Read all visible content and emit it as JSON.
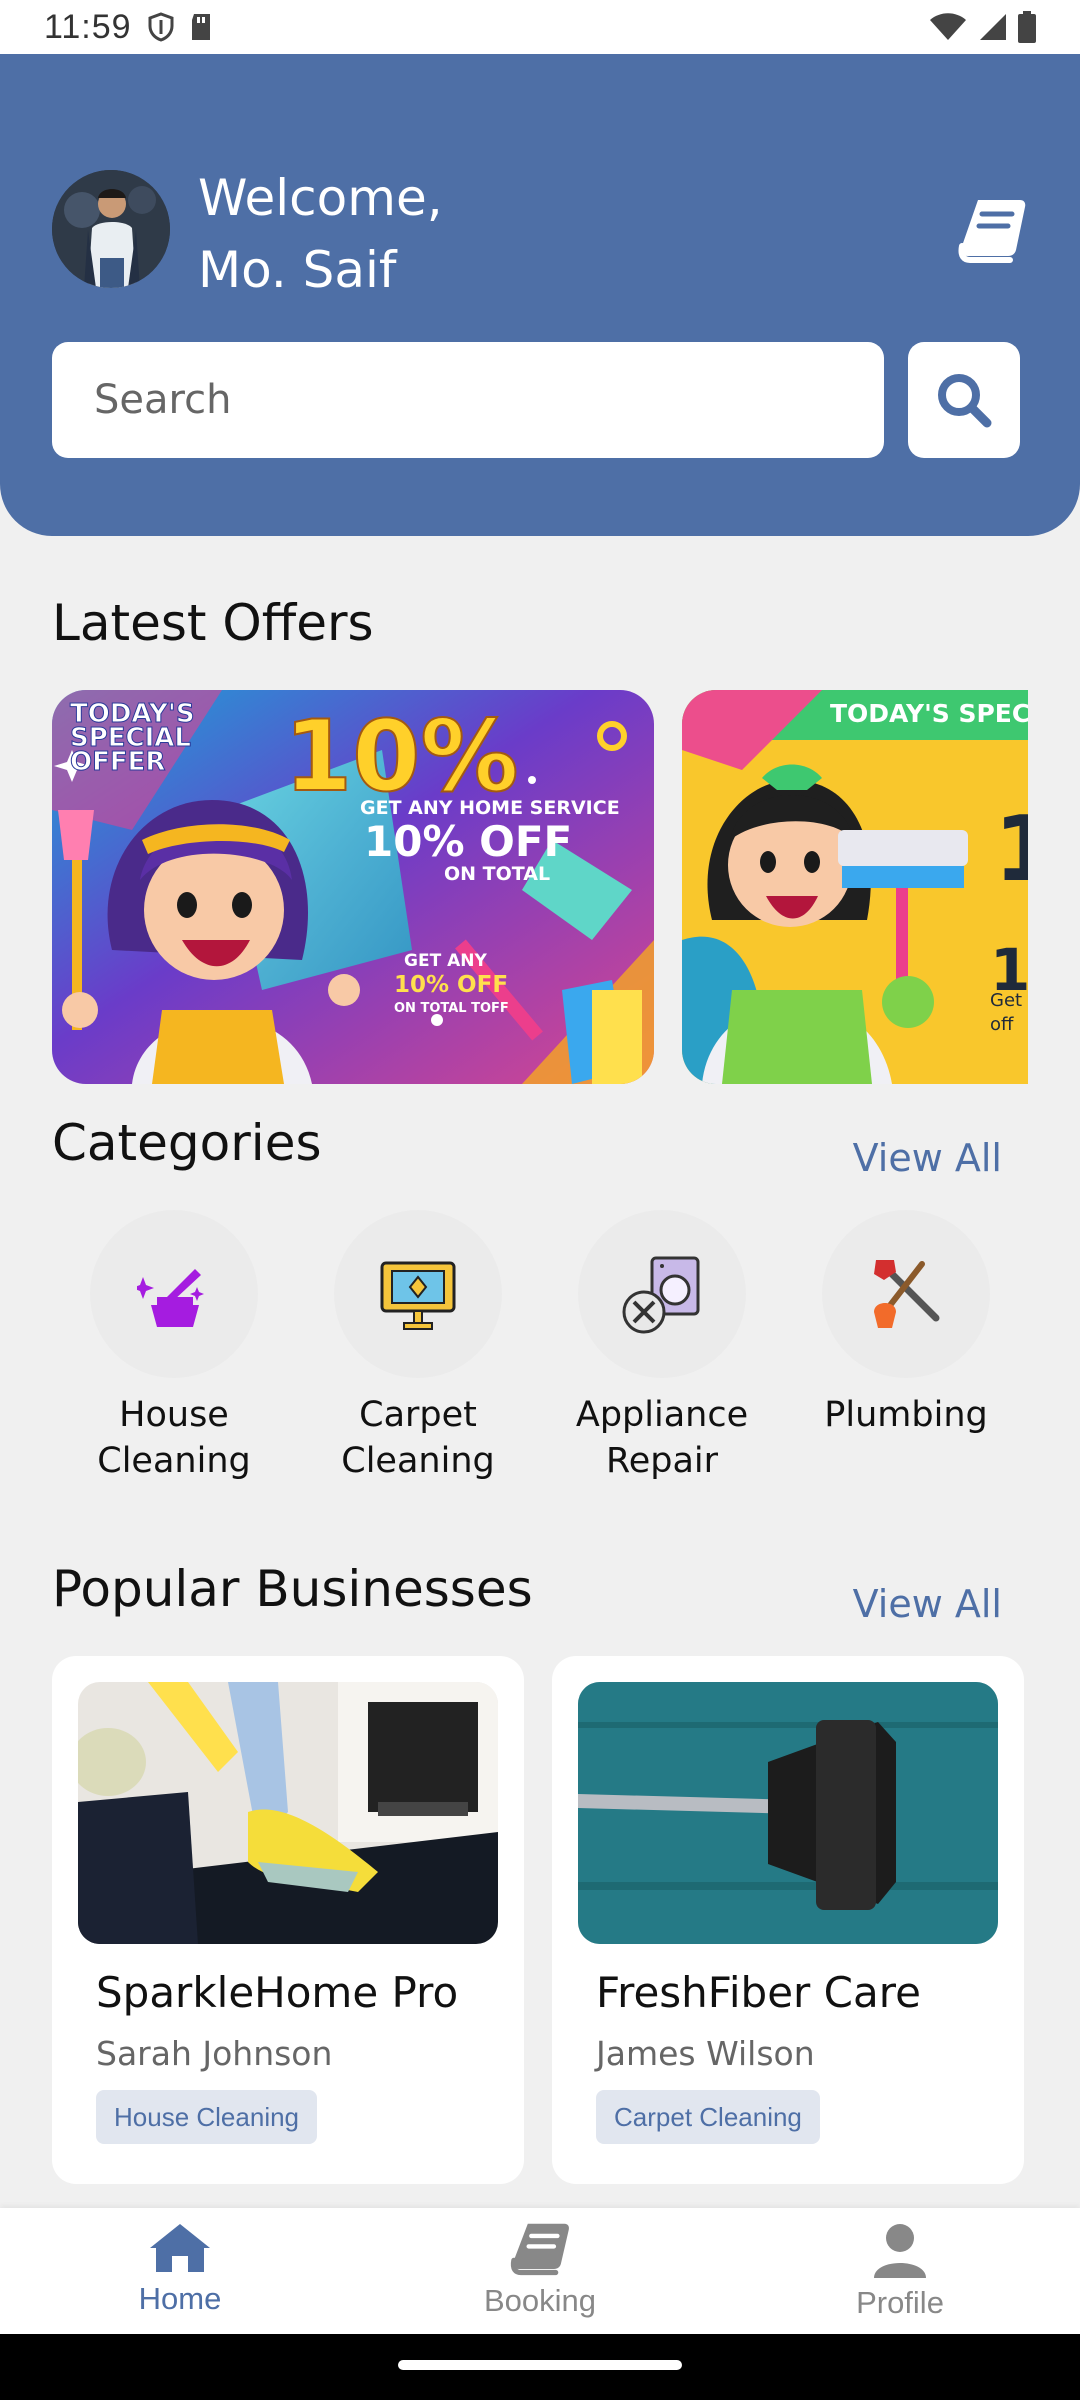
{
  "status_bar": {
    "time": "11:59"
  },
  "header": {
    "welcome_line1": "Welcome,",
    "welcome_line2": "Mo. Saif",
    "search_placeholder": "Search"
  },
  "offers": {
    "title": "Latest Offers",
    "cards": [
      {
        "badge_line1": "TODAY'S",
        "badge_line2": "SPECIAL",
        "badge_line3": "OFFER",
        "big": "10%",
        "line1": "GET ANY HOME SERVICE",
        "line2": "10% OFF",
        "line3": "ON TOTAL",
        "tag1": "GET ANY",
        "tag2": "10% OFF",
        "tag3": "ON TOTAL TOFF"
      },
      {
        "badge": "TODAY'S SPEC",
        "big": "1",
        "small1": "1",
        "small2": "Get",
        "small3": "off"
      }
    ]
  },
  "categories": {
    "title": "Categories",
    "view_all": "View All",
    "items": [
      {
        "line1": "House",
        "line2": "Cleaning",
        "icon": "house-cleaning-icon"
      },
      {
        "line1": "Carpet",
        "line2": "Cleaning",
        "icon": "carpet-cleaning-icon"
      },
      {
        "line1": "Appliance",
        "line2": "Repair",
        "icon": "appliance-repair-icon"
      },
      {
        "line1": "Plumbing",
        "line2": "",
        "icon": "plumbing-icon"
      }
    ]
  },
  "businesses": {
    "title": "Popular Businesses",
    "view_all": "View All",
    "items": [
      {
        "name": "SparkleHome Pro",
        "owner": "Sarah Johnson",
        "tag": "House Cleaning"
      },
      {
        "name": "FreshFiber Care",
        "owner": "James Wilson",
        "tag": "Carpet Cleaning"
      }
    ]
  },
  "nav": {
    "items": [
      {
        "label": "Home",
        "active": true
      },
      {
        "label": "Booking",
        "active": false
      },
      {
        "label": "Profile",
        "active": false
      }
    ]
  },
  "colors": {
    "primary": "#4e6fa6",
    "inactive": "#888888"
  }
}
